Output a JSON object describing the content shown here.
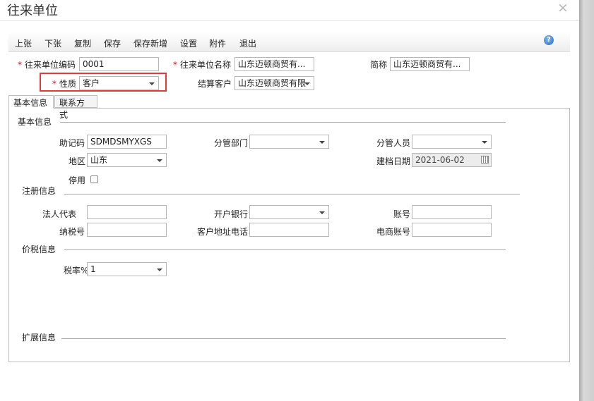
{
  "window": {
    "title": "往来单位",
    "close_glyph": "×"
  },
  "toolbar": {
    "buttons": [
      "上张",
      "下张",
      "复制",
      "保存",
      "保存新增",
      "设置",
      "附件",
      "退出"
    ],
    "help_glyph": "?"
  },
  "header_fields": {
    "code": {
      "label": "往来单位编码",
      "value": "0001",
      "required": true
    },
    "name": {
      "label": "往来单位名称",
      "value": "山东迈顿商贸有...",
      "required": true
    },
    "short_name": {
      "label": "简称",
      "value": "山东迈顿商贸有..."
    },
    "nature": {
      "label": "性质",
      "value": "客户",
      "required": true
    },
    "settle_customer": {
      "label": "结算客户",
      "value": "山东迈顿商贸有限"
    }
  },
  "tabs": [
    "基本信息",
    "联系方式"
  ],
  "sections": {
    "basic": "基本信息",
    "registration": "注册信息",
    "tax": "价税信息",
    "extension": "扩展信息"
  },
  "basic_fields": {
    "mnemonic": {
      "label": "助记码",
      "value": "SDMDSMYXGS"
    },
    "dept": {
      "label": "分管部门",
      "value": ""
    },
    "staff": {
      "label": "分管人员",
      "value": ""
    },
    "region": {
      "label": "地区",
      "value": "山东"
    },
    "created_date": {
      "label": "建档日期",
      "value": "2021-06-02"
    },
    "disabled": {
      "label": "停用",
      "checked": false
    }
  },
  "registration_fields": {
    "legal_rep": {
      "label": "法人代表",
      "value": ""
    },
    "bank": {
      "label": "开户银行",
      "value": ""
    },
    "account": {
      "label": "账号",
      "value": ""
    },
    "tax_no": {
      "label": "纳税号",
      "value": ""
    },
    "address_phone": {
      "label": "客户地址电话",
      "value": ""
    },
    "ecommerce_account": {
      "label": "电商账号",
      "value": ""
    }
  },
  "tax_fields": {
    "tax_rate": {
      "label": "税率%",
      "value": "1"
    }
  },
  "colors": {
    "required_mark": "#d0121c",
    "highlight_border": "#e23a3a"
  }
}
